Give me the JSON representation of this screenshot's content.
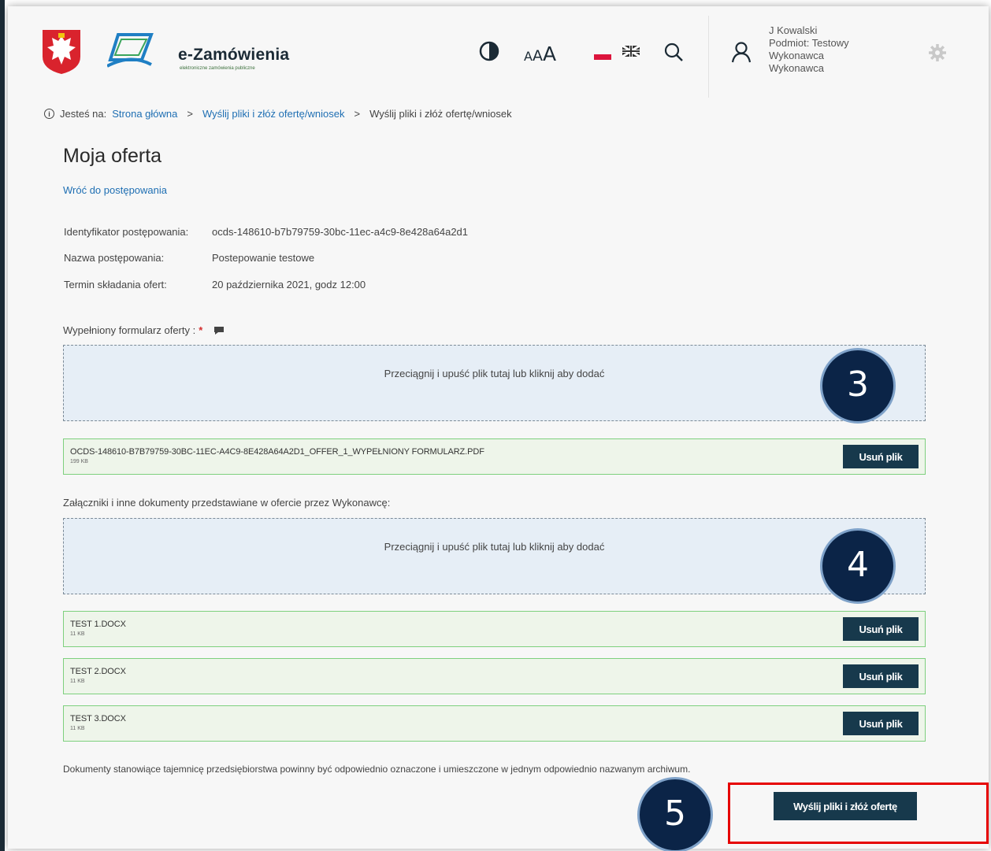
{
  "header": {
    "brand_name": "e-Zamówienia",
    "brand_sub": "elektroniczne zamówienia publiczne",
    "font_small": "A",
    "font_medium": "A",
    "font_large": "A",
    "user": {
      "line1": "J Kowalski",
      "line2": "Podmiot: Testowy",
      "line3": "Wykonawca",
      "line4": "Wykonawca"
    }
  },
  "breadcrumb": {
    "prefix": "Jesteś na:",
    "items": [
      "Strona główna",
      "Wyślij pliki i złóż ofertę/wniosek",
      "Wyślij pliki i złóż ofertę/wniosek"
    ]
  },
  "page": {
    "title": "Moja oferta",
    "back_link": "Wróć do postępowania"
  },
  "meta": [
    {
      "label": "Identyfikator postępowania:",
      "value": "ocds-148610-b7b79759-30bc-11ec-a4c9-8e428a64a2d1"
    },
    {
      "label": "Nazwa postępowania:",
      "value": "Postepowanie testowe"
    },
    {
      "label": "Termin składania ofert:",
      "value": "20 października 2021, godz 12:00"
    }
  ],
  "form_section": {
    "label": "Wypełniony formularz oferty :",
    "required_mark": "*",
    "dropzone_text": "Przeciągnij i upuść plik tutaj lub kliknij aby dodać",
    "files": [
      {
        "name": "OCDS-148610-B7B79759-30BC-11EC-A4C9-8E428A64A2D1_OFFER_1_WYPEŁNIONY FORMULARZ.PDF",
        "size": "199 KB"
      }
    ]
  },
  "attachments_section": {
    "label": "Załączniki i inne dokumenty przedstawiane w ofercie przez Wykonawcę:",
    "dropzone_text": "Przeciągnij i upuść plik tutaj lub kliknij aby dodać",
    "files": [
      {
        "name": "TEST 1.DOCX",
        "size": "11 KB"
      },
      {
        "name": "TEST 2.DOCX",
        "size": "11 KB"
      },
      {
        "name": "TEST 3.DOCX",
        "size": "11 KB"
      }
    ]
  },
  "remove_label": "Usuń plik",
  "note": "Dokumenty stanowiące tajemnicę przedsiębiorstwa powinny być odpowiednio oznaczone i umieszczone w jednym odpowiednio nazwanym archiwum.",
  "submit_label": "Wyślij pliki i złóż ofertę",
  "badges": [
    "3",
    "4",
    "5"
  ],
  "colors": {
    "primary_button": "#17394c",
    "link": "#1f6fb3",
    "badge": "#0b2447",
    "highlight": "#e60000",
    "dropzone": "#e6eef6",
    "file_row": "#eef5ea"
  }
}
